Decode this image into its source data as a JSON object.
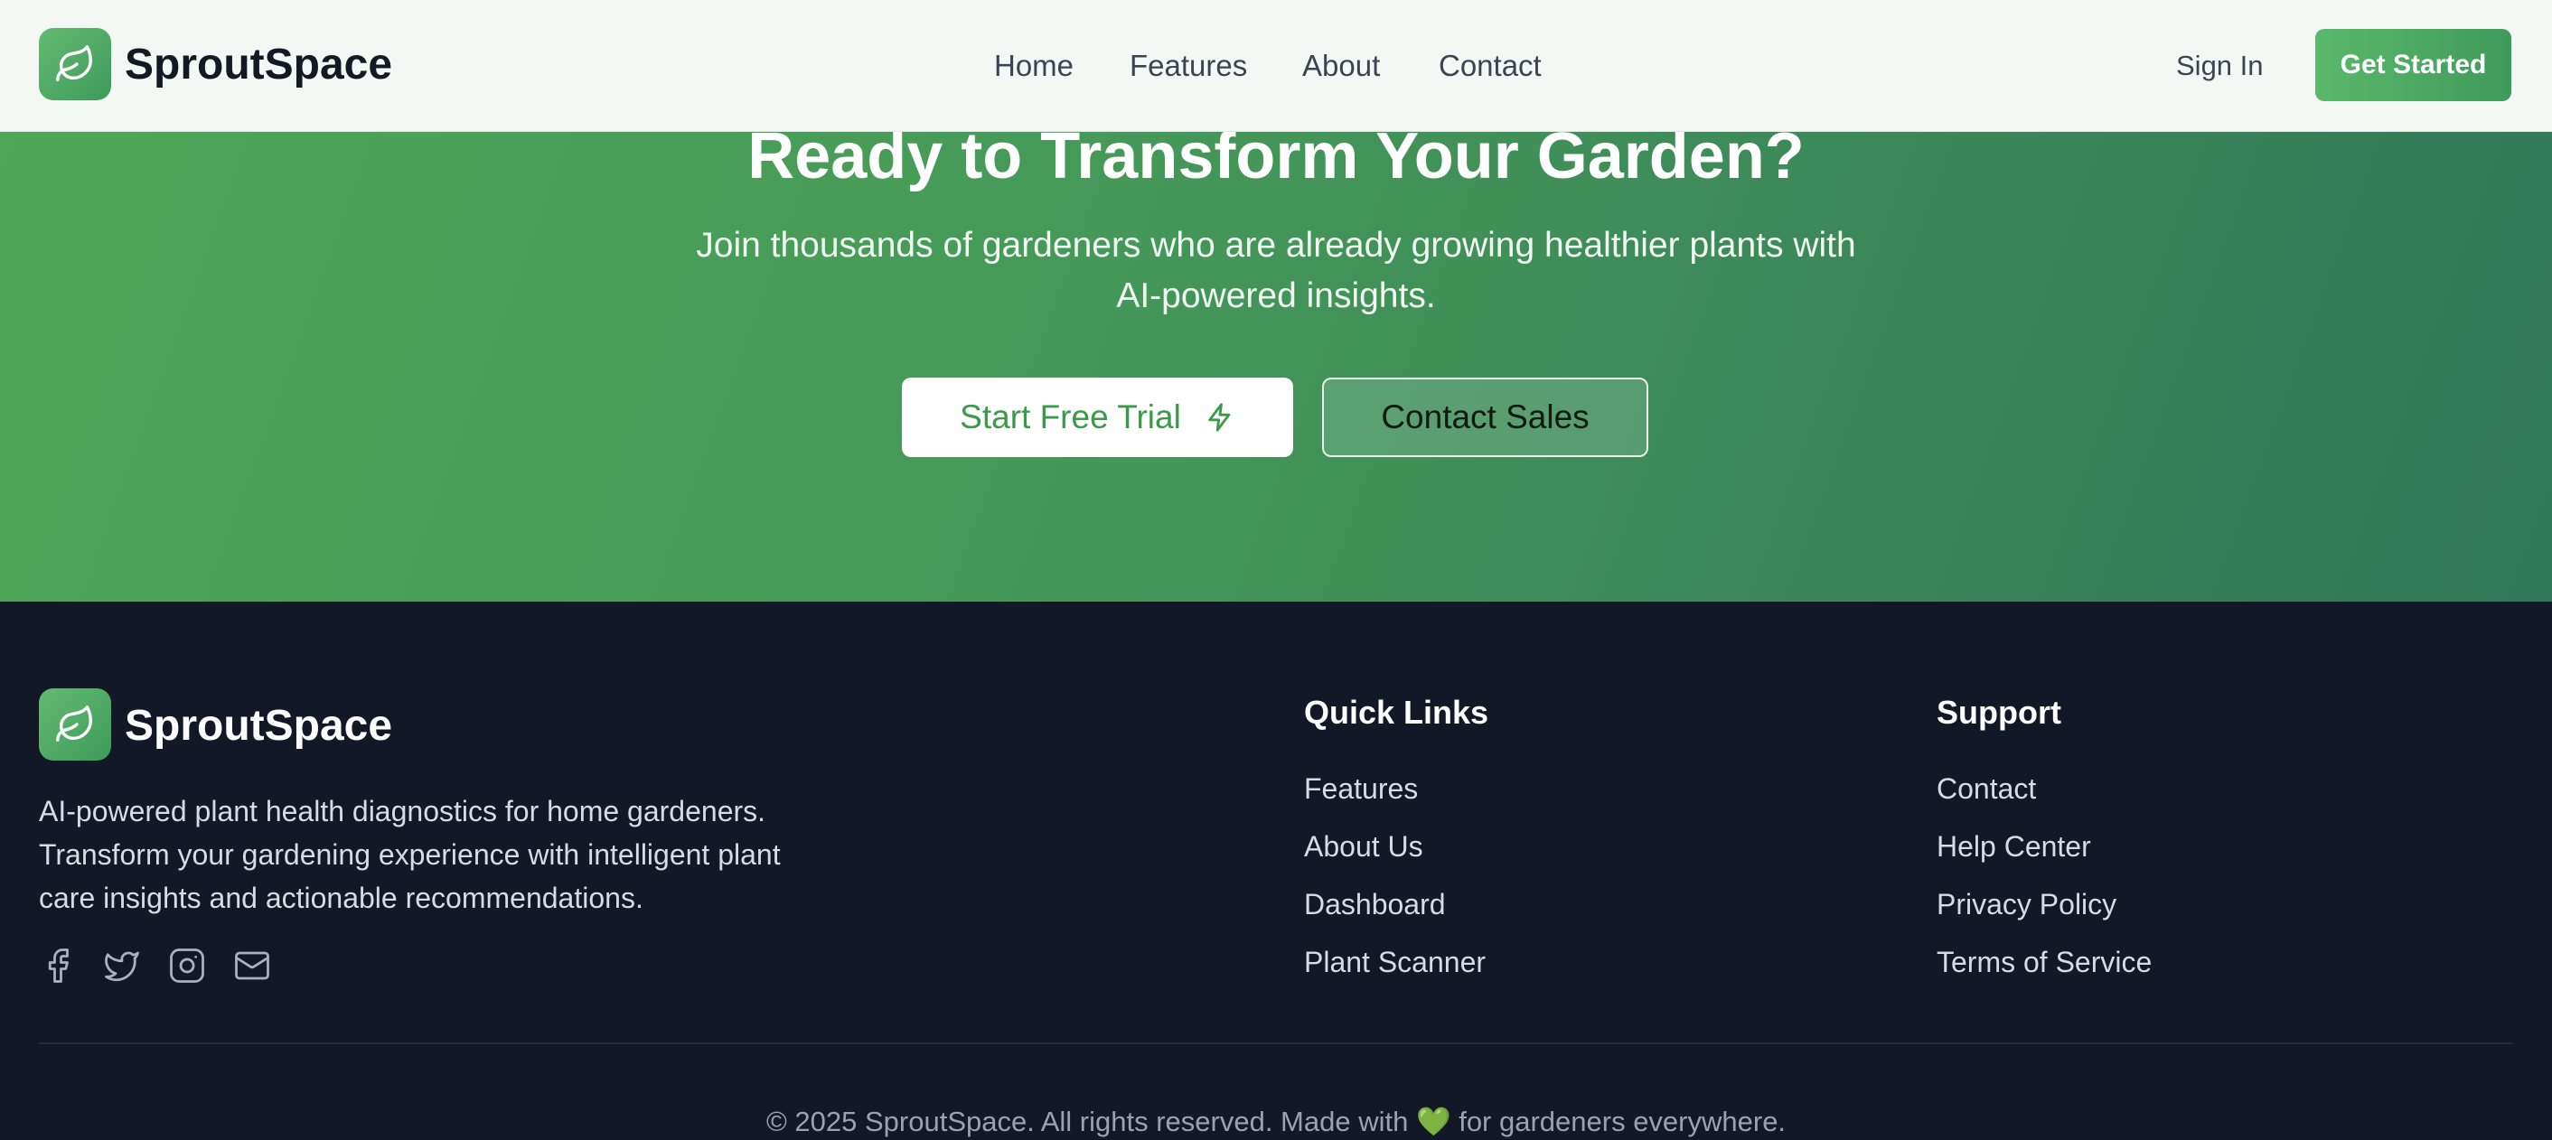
{
  "brand": {
    "name": "SproutSpace",
    "logo_icon": "leaf-icon"
  },
  "nav": {
    "links": [
      "Home",
      "Features",
      "About",
      "Contact"
    ],
    "sign_in": "Sign In",
    "cta": "Get Started"
  },
  "hero": {
    "title": "Ready to Transform Your Garden?",
    "subtitle_line1": "Join thousands of gardeners who are already growing healthier plants with",
    "subtitle_line2": "AI-powered insights.",
    "primary_button": "Start Free Trial",
    "primary_button_icon": "zap-icon",
    "secondary_button": "Contact Sales"
  },
  "footer": {
    "description_line1": "AI-powered plant health diagnostics for home gardeners.",
    "description_line2": "Transform your gardening experience with intelligent plant",
    "description_line3": "care insights and actionable recommendations.",
    "social_icons": [
      "facebook-icon",
      "twitter-icon",
      "instagram-icon",
      "mail-icon"
    ],
    "quick_links": {
      "title": "Quick Links",
      "items": [
        "Features",
        "About Us",
        "Dashboard",
        "Plant Scanner"
      ]
    },
    "support": {
      "title": "Support",
      "items": [
        "Contact",
        "Help Center",
        "Privacy Policy",
        "Terms of Service"
      ]
    },
    "copyright_prefix": "© 2025 SproutSpace. All rights reserved. Made with",
    "copyright_heart": "💚",
    "copyright_suffix": "for gardeners everywhere."
  },
  "colors": {
    "accent_green": "#4fa657",
    "dark_bg": "#131826",
    "nav_bg": "#f3f8f5"
  }
}
